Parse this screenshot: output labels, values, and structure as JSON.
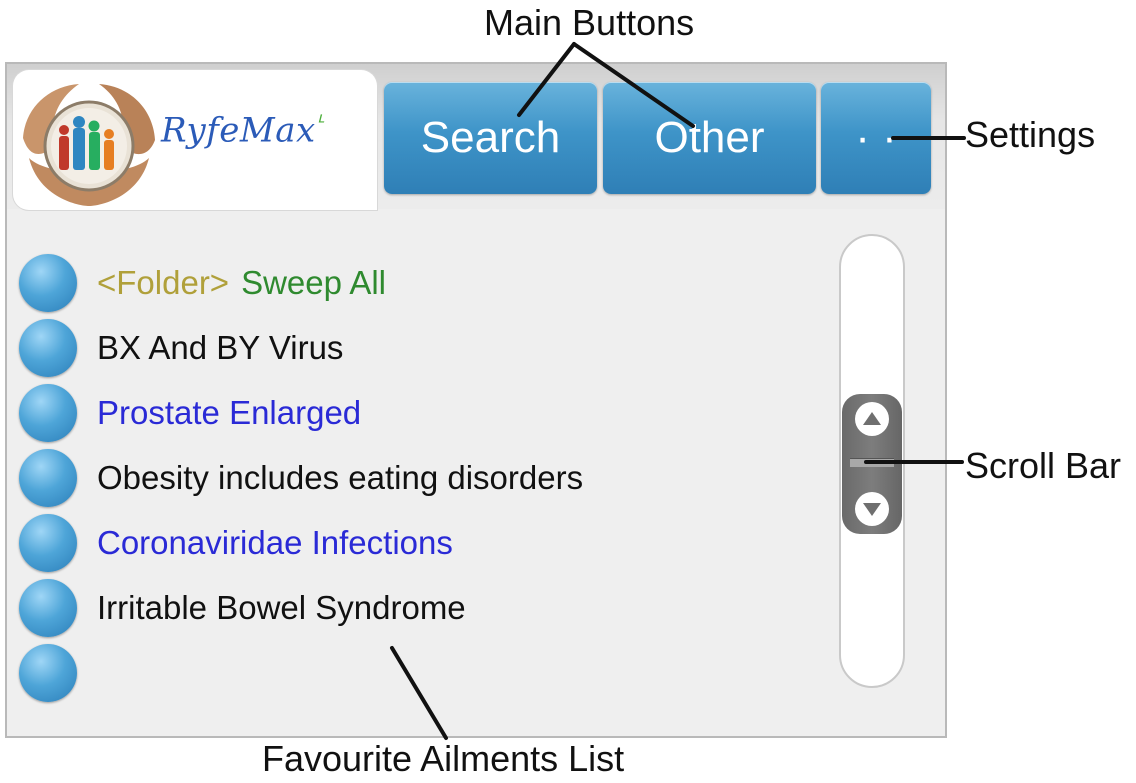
{
  "annotations": {
    "main_buttons": "Main Buttons",
    "settings": "Settings",
    "scroll_bar": "Scroll Bar",
    "favourite_list": "Favourite Ailments List"
  },
  "logo": {
    "brand": "RyfeMax"
  },
  "buttons": {
    "search": "Search",
    "other": "Other",
    "settings": "· ·"
  },
  "favourites": [
    {
      "folder_tag": "<Folder>",
      "label": "Sweep All"
    },
    {
      "label": "BX And BY Virus"
    },
    {
      "label": "Prostate Enlarged"
    },
    {
      "label": "Obesity includes eating disorders"
    },
    {
      "label": "Coronaviridae Infections"
    },
    {
      "label": "Irritable Bowel Syndrome"
    },
    {
      "label": ""
    }
  ],
  "colors": {
    "button_blue": "#3e94c8",
    "text_black": "#111111",
    "text_blue": "#2a2ad6",
    "folder_tag": "#b0a03a",
    "folder_name": "#2f8a2f"
  }
}
